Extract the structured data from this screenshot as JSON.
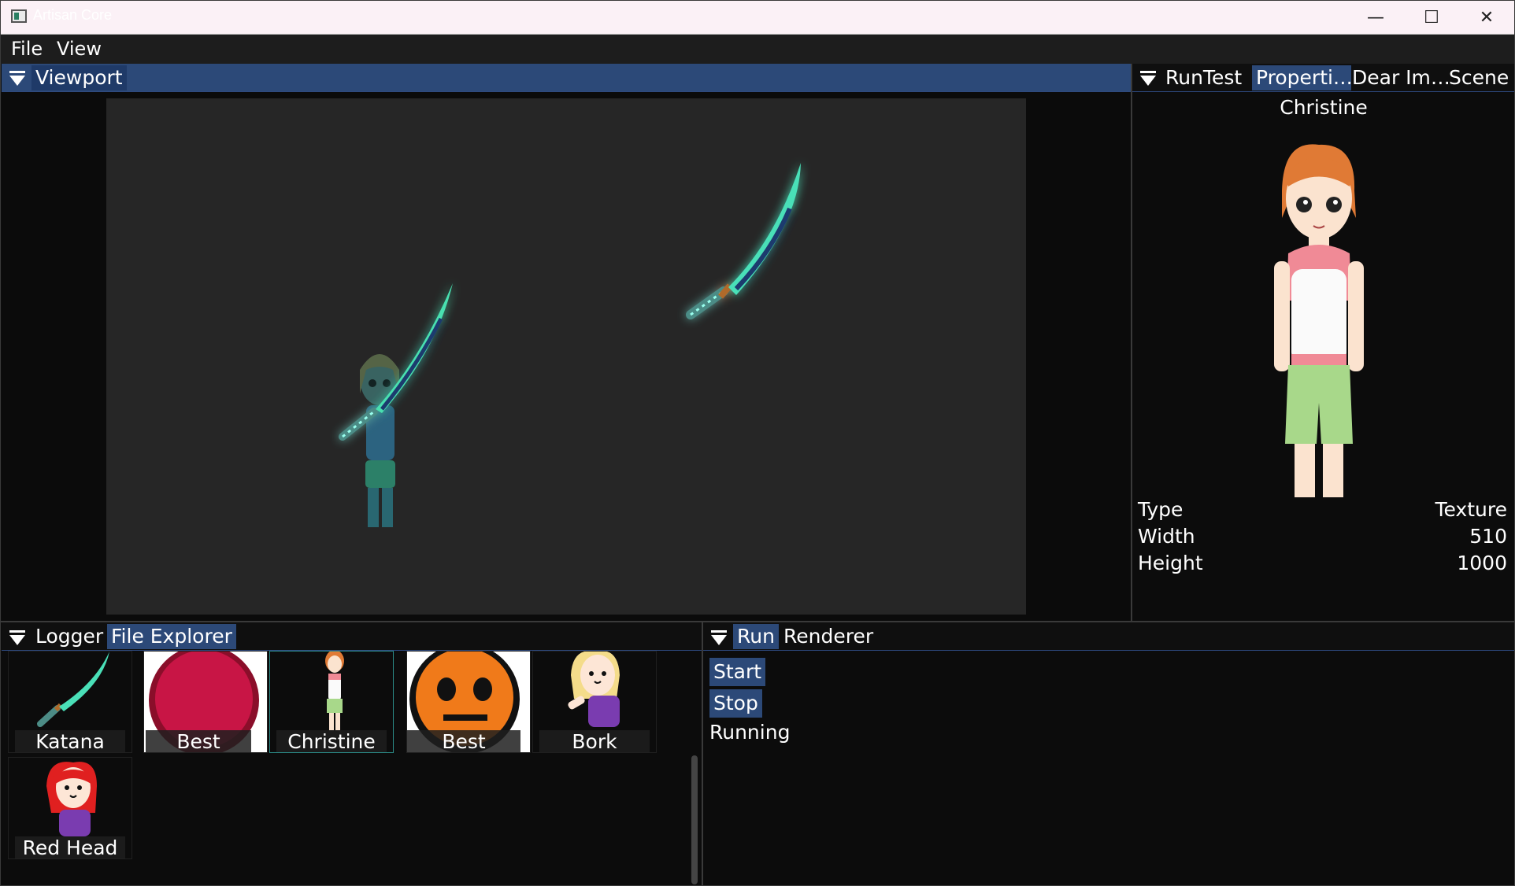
{
  "window": {
    "title": "Artisan Core",
    "controls": [
      "—",
      "☐",
      "✕"
    ]
  },
  "menu": {
    "items": [
      "File",
      "View"
    ]
  },
  "viewport": {
    "tab": "Viewport"
  },
  "right_panel": {
    "tabs": [
      "RunTest",
      "Properti…",
      "Dear Im…",
      "Scene"
    ],
    "selected_tab": "Properti…",
    "asset_name": "Christine",
    "properties": [
      {
        "key": "Type",
        "value": "Texture"
      },
      {
        "key": "Width",
        "value": "510"
      },
      {
        "key": "Height",
        "value": "1000"
      }
    ]
  },
  "bottom_left": {
    "tabs": [
      "Logger",
      "File Explorer"
    ],
    "selected_tab": "File Explorer",
    "files": [
      {
        "label": "Katana",
        "icon": "katana-icon"
      },
      {
        "label": "Best",
        "icon": "red-circle-icon"
      },
      {
        "label": "Christine",
        "icon": "christine-icon"
      },
      {
        "label": "Best",
        "icon": "pumpkin-face-icon"
      },
      {
        "label": "Bork",
        "icon": "bork-icon"
      },
      {
        "label": "Red Head",
        "icon": "red-head-icon"
      }
    ]
  },
  "bottom_right": {
    "tabs": [
      "Run",
      "Renderer"
    ],
    "selected_tab": "Run",
    "start_label": "Start",
    "stop_label": "Stop",
    "status": "Running"
  },
  "colors": {
    "accent": "#2c4978",
    "background": "#0c0c0c",
    "canvas": "#262626",
    "katana_glow": "#3fe0b0"
  }
}
